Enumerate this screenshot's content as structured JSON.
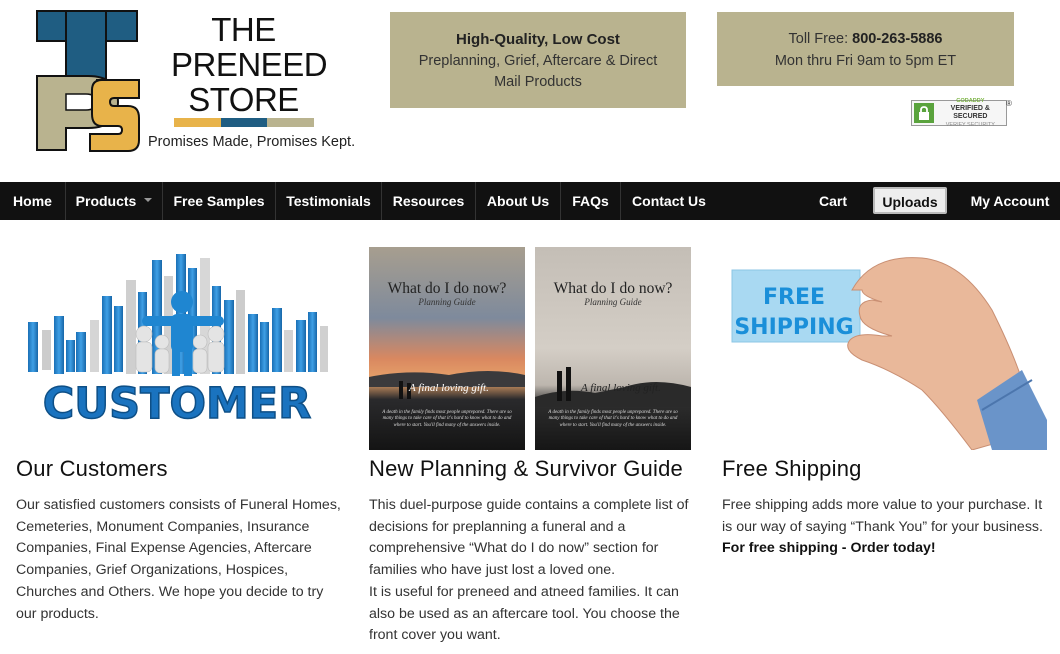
{
  "brand": {
    "name_lines": [
      "THE",
      "PRENEED",
      "STORE"
    ],
    "tagline": "Promises Made, Promises Kept.",
    "logo_letters": "TPS",
    "colors": {
      "blue": "#1f5d82",
      "tan": "#b9b38f",
      "gold": "#e8b34a",
      "nav": "#111111"
    }
  },
  "promo": {
    "headline": "High-Quality, Low Cost",
    "body": "Preplanning, Grief, Aftercare & Direct Mail Products"
  },
  "contact": {
    "toll_free_label": "Toll Free:",
    "phone": "800-263-5886",
    "hours": "Mon thru Fri 9am to 5pm ET"
  },
  "seal": {
    "brand": "GODADDY",
    "line1": "VERIFIED & SECURED",
    "line2": "VERIFY SECURITY",
    "icon": "lock-icon"
  },
  "nav": {
    "home": "Home",
    "products": "Products",
    "free_samples": "Free Samples",
    "testimonials": "Testimonials",
    "resources": "Resources",
    "about": "About Us",
    "faqs": "FAQs",
    "contact": "Contact Us",
    "cart": "Cart",
    "uploads": "Uploads",
    "account": "My Account"
  },
  "columns": {
    "customers": {
      "image_word": "CUSTOMER",
      "title": "Our Customers",
      "body": "Our satisfied customers consists of Funeral Homes, Cemeteries, Monument Companies, Insurance Companies, Final Expense Agencies, Aftercare Companies, Grief Organizations, Hospices, Churches and Others. We hope you decide to try our products."
    },
    "guide": {
      "book_title": "What do I do now?",
      "book_subtitle": "Planning Guide",
      "book_gift": "A final loving gift.",
      "book_fine": "A death in the family finds most people unprepared. There are so many things to take care of that it's hard to know what to do and where to start. You'll find many of the answers inside.",
      "title": "New Planning & Survivor Guide",
      "body_1": "This duel-purpose guide contains a complete list of decisions for preplanning a funeral and a comprehensive “What do I do now” section for families who have just lost a loved one.",
      "body_2": "It is useful for preneed and atneed families. It can also be used as an aftercare tool. You choose the front cover you want."
    },
    "shipping": {
      "card_line1": "FREE",
      "card_line2": "SHIPPING",
      "title": "Free Shipping",
      "body": "Free shipping adds more value to your purchase. It is our way of saying “Thank You” for your business.",
      "cta": "For free shipping - Order today!"
    }
  }
}
